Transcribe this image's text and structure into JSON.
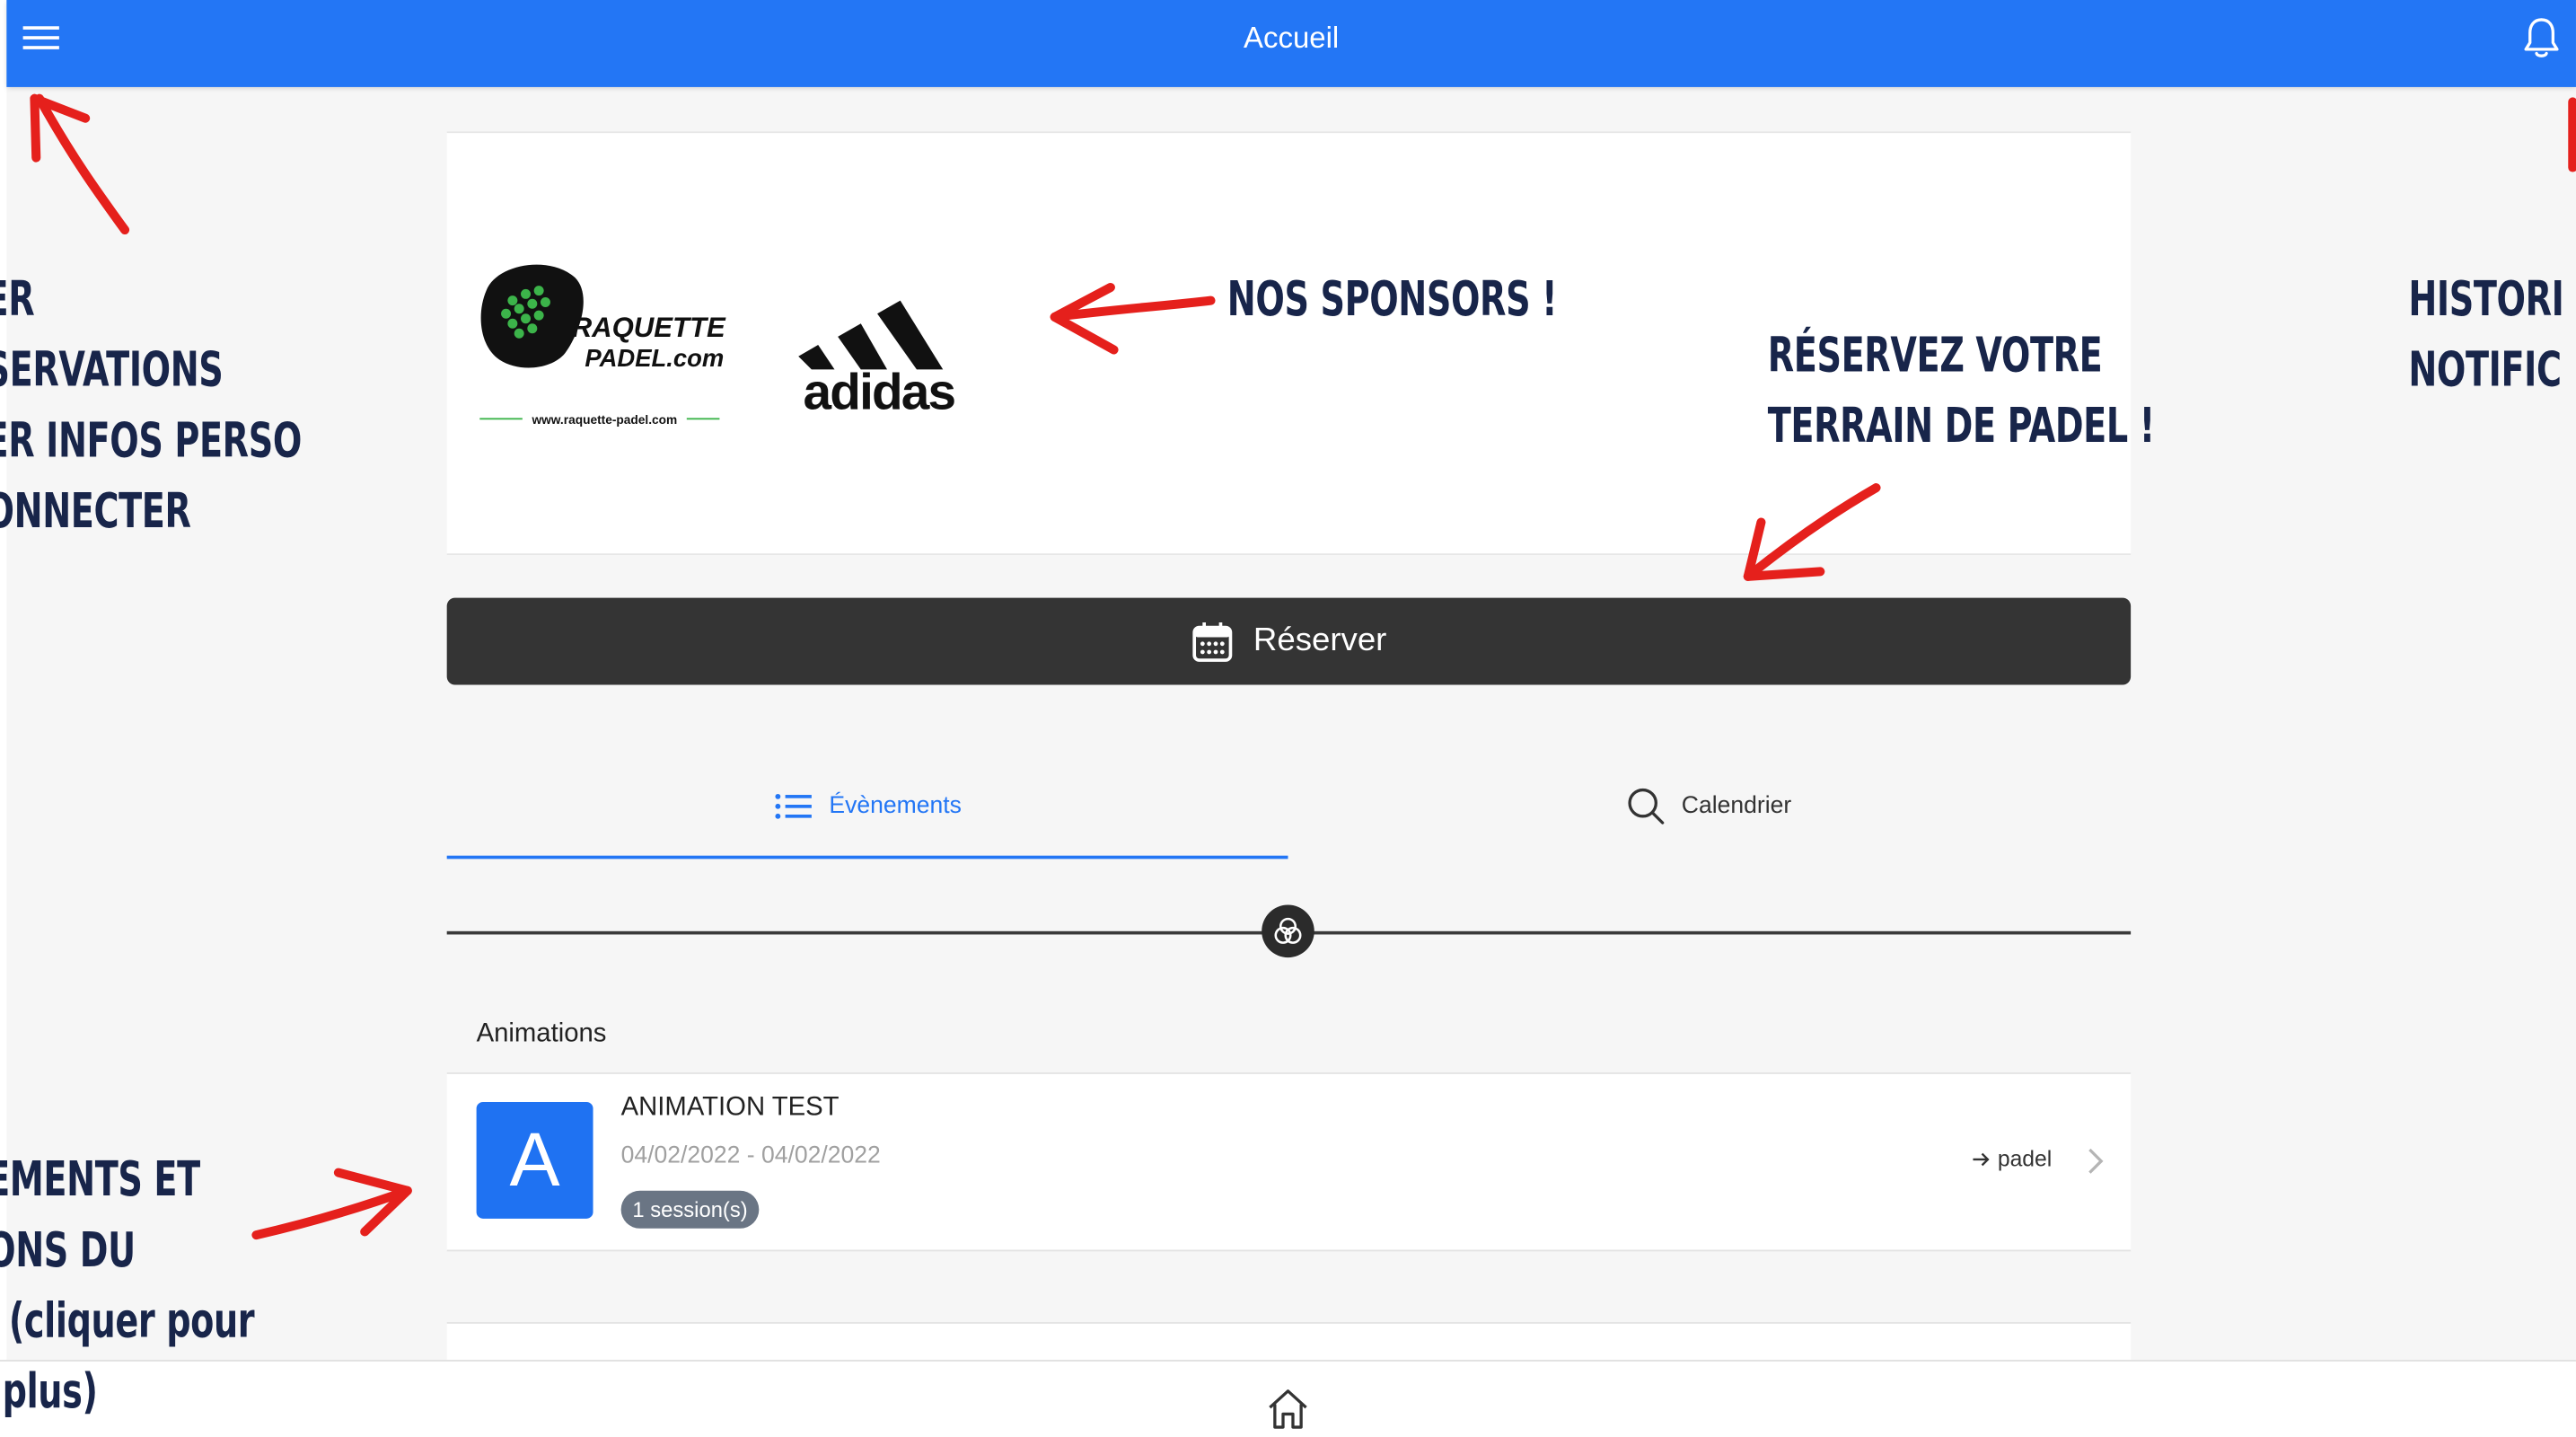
{
  "header": {
    "title": "Accueil",
    "background_color": "#2376f5",
    "menu_icon": "hamburger-menu-icon",
    "notification_icon": "bell-icon"
  },
  "sponsors": {
    "raquette_logo_text_line1": "RAQUETTE",
    "raquette_logo_text_line2": "PADEL.com",
    "raquette_logo_url": "www.raquette-padel.com",
    "adidas_logo_text": "adidas"
  },
  "reserve_button": {
    "label": "Réserver",
    "icon": "calendar-icon",
    "background_color": "#343434"
  },
  "tabs": [
    {
      "label": "Évènements",
      "icon": "list-icon",
      "active": true
    },
    {
      "label": "Calendrier",
      "icon": "search-icon",
      "active": false
    }
  ],
  "section": {
    "title": "Animations"
  },
  "event": {
    "avatar_letter": "A",
    "name": "ANIMATION TEST",
    "dates": "04/02/2022 - 04/02/2022",
    "sessions": "1 session(s)",
    "tag": "padel"
  },
  "bottom_nav": {
    "icon": "home-icon"
  },
  "annotations": {
    "menu_note": [
      "",
      "ER",
      "SERVATIONS",
      "ER INFOS PERSO",
      "ONNECTER"
    ],
    "sponsors_note": "NOS SPONSORS !",
    "reserve_note": [
      "RÉSERVEZ VOTRE",
      "TERRAIN DE PADEL !"
    ],
    "notifications_note": [
      "HISTORI",
      "NOTIFIC"
    ],
    "events_note": [
      "IEMENTS ET",
      "IONS DU",
      "T (cliquer pour",
      "r plus)"
    ],
    "arrow_color": "#e5201c",
    "text_color": "#18254a"
  }
}
